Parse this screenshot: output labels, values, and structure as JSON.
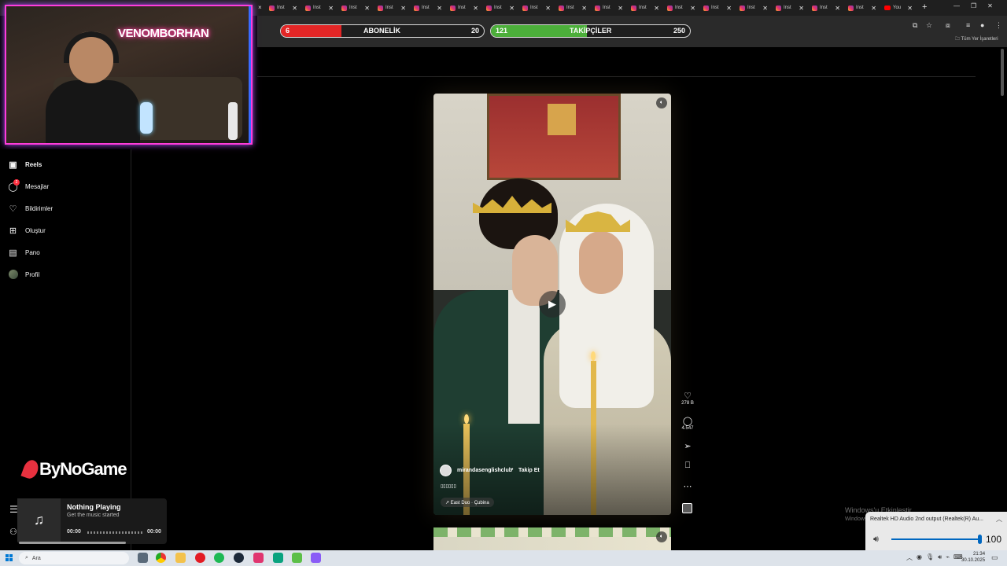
{
  "browser": {
    "tabs": [
      {
        "label": "Inst",
        "icon": "instagram-icon"
      },
      {
        "label": "Inst",
        "icon": "instagram-icon"
      },
      {
        "label": "Inst",
        "icon": "instagram-icon"
      },
      {
        "label": "Inst",
        "icon": "instagram-icon"
      },
      {
        "label": "Inst",
        "icon": "instagram-icon"
      },
      {
        "label": "Inst",
        "icon": "instagram-icon"
      },
      {
        "label": "Inst",
        "icon": "instagram-icon"
      },
      {
        "label": "Inst",
        "icon": "instagram-icon"
      },
      {
        "label": "Inst",
        "icon": "instagram-icon"
      },
      {
        "label": "Inst",
        "icon": "instagram-icon"
      },
      {
        "label": "Inst",
        "icon": "instagram-icon"
      },
      {
        "label": "Inst",
        "icon": "instagram-icon"
      },
      {
        "label": "Inst",
        "icon": "instagram-icon"
      },
      {
        "label": "Inst",
        "icon": "instagram-icon"
      },
      {
        "label": "Inst",
        "icon": "instagram-icon"
      },
      {
        "label": "Inst",
        "icon": "instagram-icon"
      },
      {
        "label": "Inst",
        "icon": "instagram-icon"
      },
      {
        "label": "You",
        "icon": "youtube-icon"
      }
    ],
    "new_tab": "+",
    "bookmarks_label": "Tüm Yer İşaretleri"
  },
  "goals": {
    "subscribers": {
      "current": "6",
      "label": "ABONELİK",
      "target": "20",
      "progress": 0.3,
      "color": "#e32626"
    },
    "followers": {
      "current": "121",
      "label": "TAKİPÇİLER",
      "target": "250",
      "progress": 0.484,
      "color": "#4caf3a"
    }
  },
  "webcam": {
    "neon_sign": "VENOMBORHAN"
  },
  "sidebar": {
    "items": [
      {
        "label": "Reels",
        "icon": "reels-icon",
        "active": true
      },
      {
        "label": "Mesajlar",
        "icon": "messenger-icon",
        "badge": "2"
      },
      {
        "label": "Bildirimler",
        "icon": "heart-icon"
      },
      {
        "label": "Oluştur",
        "icon": "plus-square-icon"
      },
      {
        "label": "Pano",
        "icon": "dashboard-icon"
      },
      {
        "label": "Profil",
        "icon": "avatar"
      }
    ]
  },
  "sponsor": {
    "text": "ByNoGame"
  },
  "music": {
    "title": "Nothing Playing",
    "subtitle": "Get the music started",
    "time_start": "00:00",
    "time_end": "00:00"
  },
  "reel": {
    "author": "mirandasenglishclub",
    "separator": "•",
    "follow_label": "Takip Et",
    "caption": "▯▯▯▯▯▯",
    "audio": "↗ East Duo · Çubina",
    "likes": "278 B",
    "comments": "4.547"
  },
  "watermark": {
    "line1": "Windows'u Etkinleştir",
    "line2": "Windows'u etkinleştirmek için Ayarlar'a gidin."
  },
  "volume": {
    "device": "Realtek HD Audio 2nd output (Realtek(R) Au...",
    "value": "100",
    "level": 1.0
  },
  "taskbar": {
    "search_placeholder": "Ara",
    "time": "21:34",
    "date": "30.10.2025"
  }
}
